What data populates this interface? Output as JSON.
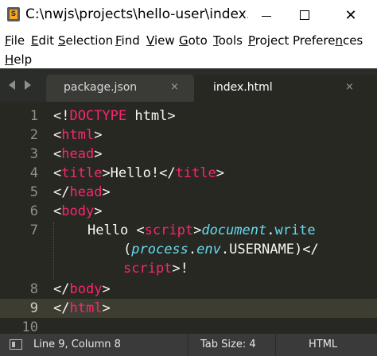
{
  "window": {
    "title": "C:\\nwjs\\projects\\hello-user\\index.ht...",
    "controls": {
      "minimize": "minimize",
      "maximize": "maximize",
      "close": "✕"
    }
  },
  "menu": [
    {
      "label": "File",
      "underline": "F",
      "rest": "ile"
    },
    {
      "label": "Edit",
      "underline": "E",
      "rest": "dit"
    },
    {
      "label": "Selection",
      "underline": "S",
      "rest": "election"
    },
    {
      "label": "Find",
      "underline": "F",
      "rest": "ind"
    },
    {
      "label": "View",
      "underline": "V",
      "rest": "iew"
    },
    {
      "label": "Goto",
      "underline": "G",
      "rest": "oto"
    },
    {
      "label": "Tools",
      "underline": "T",
      "rest": "ools"
    },
    {
      "label": "Project",
      "underline": "P",
      "rest": "roject"
    },
    {
      "label": "Preferences",
      "underline": "n",
      "pre": "Prefere",
      "rest": "ces"
    },
    {
      "label": "Help",
      "underline": "H",
      "rest": "elp"
    }
  ],
  "tabs": [
    {
      "label": "package.json",
      "close": "×",
      "active": false
    },
    {
      "label": "index.html",
      "close": "×",
      "active": true
    }
  ],
  "line_numbers": [
    "1",
    "2",
    "3",
    "4",
    "5",
    "6",
    "7",
    "8",
    "9",
    "10"
  ],
  "current_line": "9",
  "code": {
    "l1": {
      "open": "<!",
      "tag": "DOCTYPE",
      "rest": " html>"
    },
    "l2": {
      "open": "<",
      "tag": "html",
      "close": ">"
    },
    "l3": {
      "open": "<",
      "tag": "head",
      "close": ">"
    },
    "l4": {
      "open": "<",
      "tag": "title",
      "mid": ">Hello!</",
      "tag2": "title",
      "close": ">"
    },
    "l5": {
      "open": "</",
      "tag": "head",
      "close": ">"
    },
    "l6": {
      "open": "<",
      "tag": "body",
      "close": ">"
    },
    "l7a": {
      "text": "Hello <",
      "tag": "script",
      "mid": ">",
      "fn1": "document",
      "dot": ".",
      "fn2": "write"
    },
    "l7b": {
      "open": "(",
      "fn1": "process",
      "dot1": ".",
      "fn2": "env",
      "rest": ".USERNAME)</"
    },
    "l7c": {
      "tag": "script",
      "rest": ">!"
    },
    "l8": {
      "open": "</",
      "tag": "body",
      "close": ">"
    },
    "l9": {
      "open": "</",
      "tag": "html",
      "close": ">"
    }
  },
  "status": {
    "position": "Line 9, Column 8",
    "tab_size": "Tab Size: 4",
    "syntax": "HTML"
  },
  "colors": {
    "editor_bg": "#272822",
    "tag": "#f92672",
    "function": "#66d9ef",
    "text": "#f8f8f2"
  }
}
